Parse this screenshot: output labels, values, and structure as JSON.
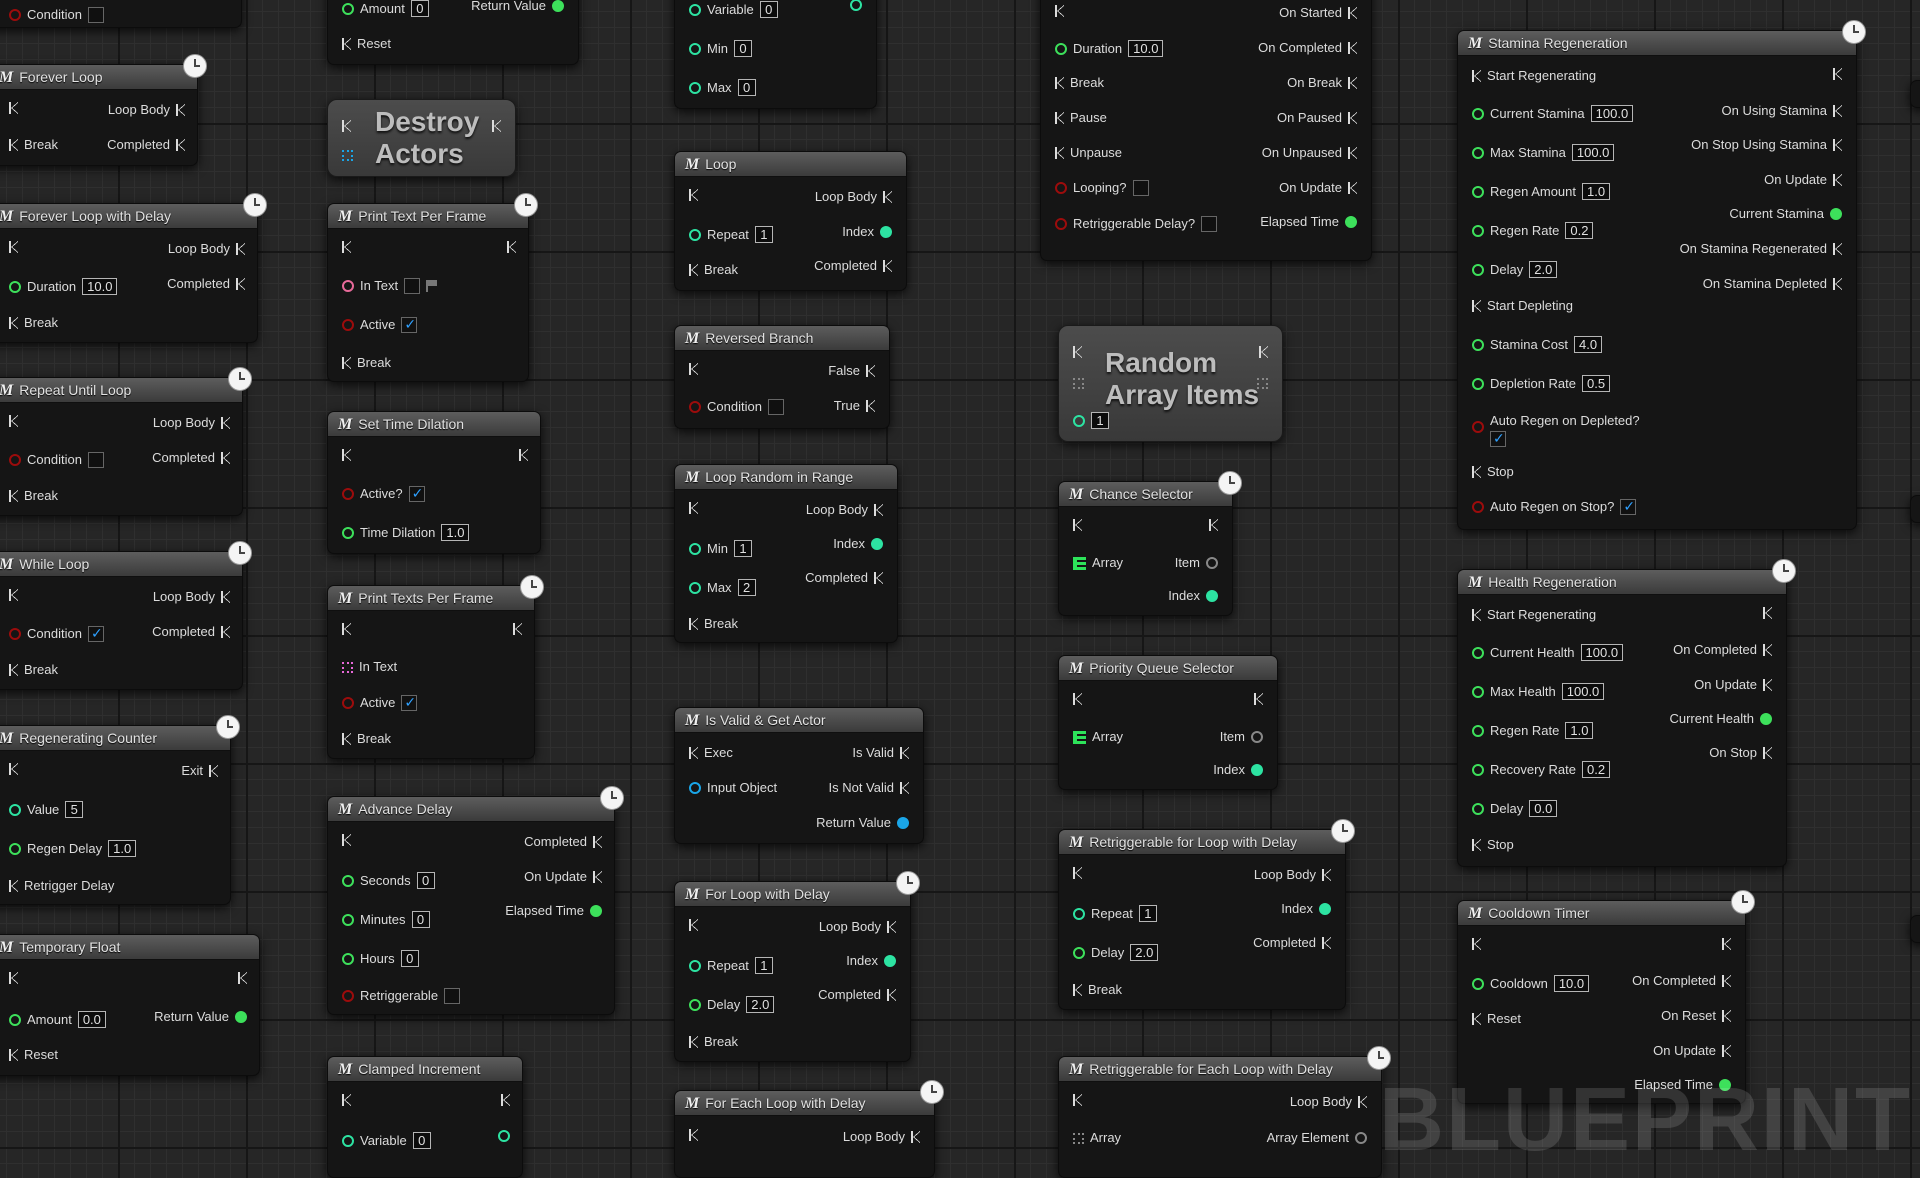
{
  "watermark": "BLUEPRINT",
  "colors": {
    "float": "#3de05b",
    "bool": "#9c0c0c",
    "object": "#1aa6e8",
    "int": "#2de3a2",
    "string": "#e868d8",
    "exec": "#dcdcdc"
  },
  "nodes": {
    "condition_top": {
      "condition": "Condition"
    },
    "amount_top": {
      "amount": "Amount",
      "amount_val": "0",
      "return_value": "Return Value",
      "reset": "Reset"
    },
    "variable_top": {
      "variable": "Variable",
      "variable_val": "0",
      "min": "Min",
      "min_val": "0",
      "max": "Max",
      "max_val": "0"
    },
    "timeline_top": {
      "on_started": "On Started",
      "duration": "Duration",
      "duration_val": "10.0",
      "on_completed": "On Completed",
      "break": "Break",
      "on_break": "On Break",
      "pause": "Pause",
      "on_paused": "On Paused",
      "unpause": "Unpause",
      "on_unpaused": "On Unpaused",
      "looping": "Looping?",
      "on_update": "On Update",
      "retriggerable": "Retriggerable Delay?",
      "elapsed": "Elapsed Time"
    },
    "forever_loop": {
      "title": "Forever Loop",
      "loop_body": "Loop Body",
      "break": "Break",
      "completed": "Completed"
    },
    "forever_loop_delay": {
      "title": "Forever Loop with Delay",
      "loop_body": "Loop Body",
      "duration": "Duration",
      "duration_val": "10.0",
      "completed": "Completed",
      "break": "Break"
    },
    "repeat_until": {
      "title": "Repeat Until Loop",
      "loop_body": "Loop Body",
      "condition": "Condition",
      "completed": "Completed",
      "break": "Break"
    },
    "while_loop": {
      "title": "While Loop",
      "loop_body": "Loop Body",
      "condition": "Condition",
      "completed": "Completed",
      "break": "Break"
    },
    "regen_counter": {
      "title": "Regenerating Counter",
      "exit": "Exit",
      "value": "Value",
      "value_val": "5",
      "regen_delay": "Regen Delay",
      "regen_delay_val": "1.0",
      "retrigger": "Retrigger Delay"
    },
    "temp_float": {
      "title": "Temporary Float",
      "amount": "Amount",
      "amount_val": "0.0",
      "return_value": "Return Value",
      "reset": "Reset"
    },
    "destroy_actors": {
      "title": "Destroy\nActors"
    },
    "print_text_frame": {
      "title": "Print Text Per Frame",
      "in_text": "In Text",
      "active": "Active",
      "break": "Break"
    },
    "set_time_dilation": {
      "title": "Set Time Dilation",
      "active": "Active?",
      "time_dilation": "Time Dilation",
      "time_dilation_val": "1.0"
    },
    "print_texts_frame": {
      "title": "Print Texts Per Frame",
      "in_text": "In Text",
      "active": "Active",
      "break": "Break"
    },
    "advance_delay": {
      "title": "Advance Delay",
      "completed": "Completed",
      "seconds": "Seconds",
      "seconds_val": "0",
      "on_update": "On Update",
      "minutes": "Minutes",
      "minutes_val": "0",
      "elapsed": "Elapsed Time",
      "hours": "Hours",
      "hours_val": "0",
      "retriggerable": "Retriggerable"
    },
    "clamped_increment": {
      "title": "Clamped Increment",
      "variable": "Variable",
      "variable_val": "0"
    },
    "loop": {
      "title": "Loop",
      "loop_body": "Loop Body",
      "repeat": "Repeat",
      "repeat_val": "1",
      "index": "Index",
      "break": "Break",
      "completed": "Completed"
    },
    "reversed_branch": {
      "title": "Reversed Branch",
      "false": "False",
      "condition": "Condition",
      "true": "True"
    },
    "loop_random_range": {
      "title": "Loop Random in Range",
      "loop_body": "Loop Body",
      "min": "Min",
      "min_val": "1",
      "index": "Index",
      "max": "Max",
      "max_val": "2",
      "completed": "Completed",
      "break": "Break"
    },
    "is_valid": {
      "title": "Is Valid & Get Actor",
      "exec": "Exec",
      "is_valid": "Is Valid",
      "input_object": "Input Object",
      "is_not_valid": "Is Not Valid",
      "return_value": "Return Value"
    },
    "for_loop_delay": {
      "title": "For Loop with Delay",
      "loop_body": "Loop Body",
      "repeat": "Repeat",
      "repeat_val": "1",
      "index": "Index",
      "delay": "Delay",
      "delay_val": "2.0",
      "completed": "Completed",
      "break": "Break"
    },
    "for_each_delay": {
      "title": "For Each Loop with Delay",
      "loop_body": "Loop Body"
    },
    "random_array": {
      "title": "Random\nArray Items",
      "count_val": "1"
    },
    "chance_selector": {
      "title": "Chance Selector",
      "array": "Array",
      "item": "Item",
      "index": "Index"
    },
    "priority_queue": {
      "title": "Priority Queue Selector",
      "array": "Array",
      "item": "Item",
      "index": "Index"
    },
    "retrig_loop_delay": {
      "title": "Retriggerable for Loop with Delay",
      "loop_body": "Loop Body",
      "repeat": "Repeat",
      "repeat_val": "1",
      "index": "Index",
      "delay": "Delay",
      "delay_val": "2.0",
      "completed": "Completed",
      "break": "Break"
    },
    "retrig_each_delay": {
      "title": "Retriggerable for Each Loop with Delay",
      "loop_body": "Loop Body",
      "array": "Array",
      "array_element": "Array Element"
    },
    "stamina_regen": {
      "title": "Stamina Regeneration",
      "start_regen": "Start Regenerating",
      "on_using": "On Using Stamina",
      "current": "Current Stamina",
      "current_val": "100.0",
      "on_stop_using": "On Stop Using Stamina",
      "max": "Max Stamina",
      "max_val": "100.0",
      "on_update": "On Update",
      "regen_amount": "Regen Amount",
      "regen_amount_val": "1.0",
      "current_out": "Current Stamina",
      "regen_rate": "Regen Rate",
      "regen_rate_val": "0.2",
      "on_regenerated": "On Stamina Regenerated",
      "delay": "Delay",
      "delay_val": "2.0",
      "on_depleted": "On Stamina Depleted",
      "start_depleting": "Start Depleting",
      "stamina_cost": "Stamina Cost",
      "stamina_cost_val": "4.0",
      "depletion_rate": "Depletion Rate",
      "depletion_rate_val": "0.5",
      "auto_regen_depleted": "Auto Regen on Depleted?",
      "stop": "Stop",
      "auto_regen_stop": "Auto Regen on Stop?"
    },
    "health_regen": {
      "title": "Health Regeneration",
      "start_regen": "Start Regenerating",
      "current": "Current Health",
      "current_val": "100.0",
      "on_completed": "On Completed",
      "max": "Max Health",
      "max_val": "100.0",
      "on_update": "On Update",
      "current_out": "Current Health",
      "regen_rate": "Regen Rate",
      "regen_rate_val": "1.0",
      "on_stop": "On Stop",
      "recovery_rate": "Recovery Rate",
      "recovery_rate_val": "0.2",
      "delay": "Delay",
      "delay_val": "0.0",
      "stop": "Stop"
    },
    "cooldown_timer": {
      "title": "Cooldown Timer",
      "cooldown": "Cooldown",
      "cooldown_val": "10.0",
      "on_completed": "On Completed",
      "reset": "Reset",
      "on_reset": "On Reset",
      "on_update": "On Update",
      "elapsed": "Elapsed Time"
    }
  }
}
